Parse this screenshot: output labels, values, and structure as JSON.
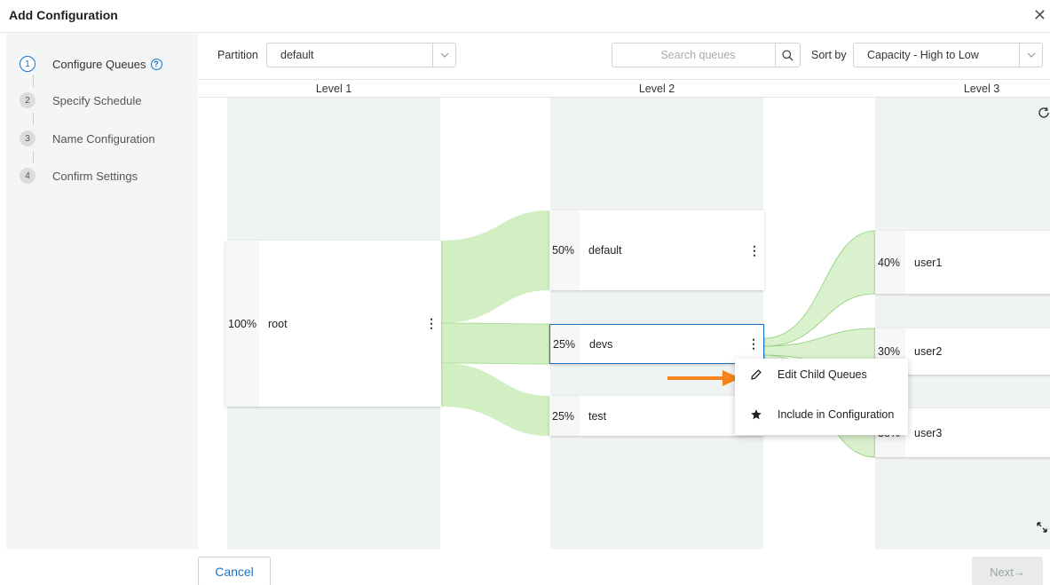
{
  "dialog": {
    "title": "Add Configuration",
    "close_glyph": "✕"
  },
  "stepper": {
    "steps": [
      {
        "number": "1",
        "label": "Configure Queues",
        "active": true
      },
      {
        "number": "2",
        "label": "Specify Schedule",
        "active": false
      },
      {
        "number": "3",
        "label": "Name Configuration",
        "active": false
      },
      {
        "number": "4",
        "label": "Confirm Settings",
        "active": false
      }
    ]
  },
  "toolbar": {
    "partition_label": "Partition",
    "partition_value": "default",
    "search_placeholder": "Search queues",
    "sort_label": "Sort by",
    "sort_value": "Capacity - High to Low"
  },
  "levels": [
    "Level 1",
    "Level 2",
    "Level 3"
  ],
  "queues": {
    "level1": [
      {
        "pct": "100%",
        "name": "root"
      }
    ],
    "level2": [
      {
        "pct": "50%",
        "name": "default"
      },
      {
        "pct": "25%",
        "name": "devs",
        "selected": true
      },
      {
        "pct": "25%",
        "name": "test"
      }
    ],
    "level3": [
      {
        "pct": "40%",
        "name": "user1"
      },
      {
        "pct": "30%",
        "name": "user2"
      },
      {
        "pct": "30%",
        "name": "user3"
      }
    ]
  },
  "context_menu": {
    "items": [
      {
        "label": "Edit Child Queues",
        "icon": "pencil-icon"
      },
      {
        "label": "Include in Configuration",
        "icon": "star-icon"
      }
    ]
  },
  "footer": {
    "cancel_label": "Cancel",
    "next_label": "Next→"
  },
  "colors": {
    "accent": "#1a73c8",
    "flow": "#c9ecb8",
    "column_bg": "#eff3f2",
    "arrow": "#f5841f"
  }
}
